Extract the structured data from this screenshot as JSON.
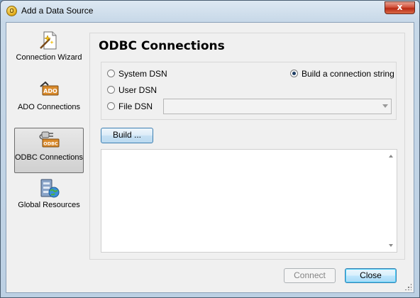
{
  "window": {
    "title": "Add a Data Source",
    "close_glyph": "x"
  },
  "sidebar": {
    "items": [
      {
        "label": "Connection Wizard",
        "icon": "wizard-icon",
        "selected": false
      },
      {
        "label": "ADO Connections",
        "icon": "ado-icon",
        "icon_text": "ADO",
        "selected": false
      },
      {
        "label": "ODBC Connections",
        "icon": "odbc-plug-icon",
        "icon_text": "ODBC",
        "selected": true
      },
      {
        "label": "Global Resources",
        "icon": "global-resources-icon",
        "selected": false
      }
    ]
  },
  "panel": {
    "title": "ODBC Connections",
    "options": {
      "system_dsn": "System DSN",
      "user_dsn": "User DSN",
      "file_dsn": "File DSN",
      "build_string": "Build a connection string"
    },
    "selected_option": "build_string",
    "dsn_select_value": "",
    "build_button": "Build ...",
    "connection_text": ""
  },
  "footer": {
    "connect_label": "Connect",
    "close_label": "Close"
  },
  "colors": {
    "accent": "#3c7fb1",
    "title_bar": "#c7d8e8",
    "close_red": "#c0392b"
  }
}
